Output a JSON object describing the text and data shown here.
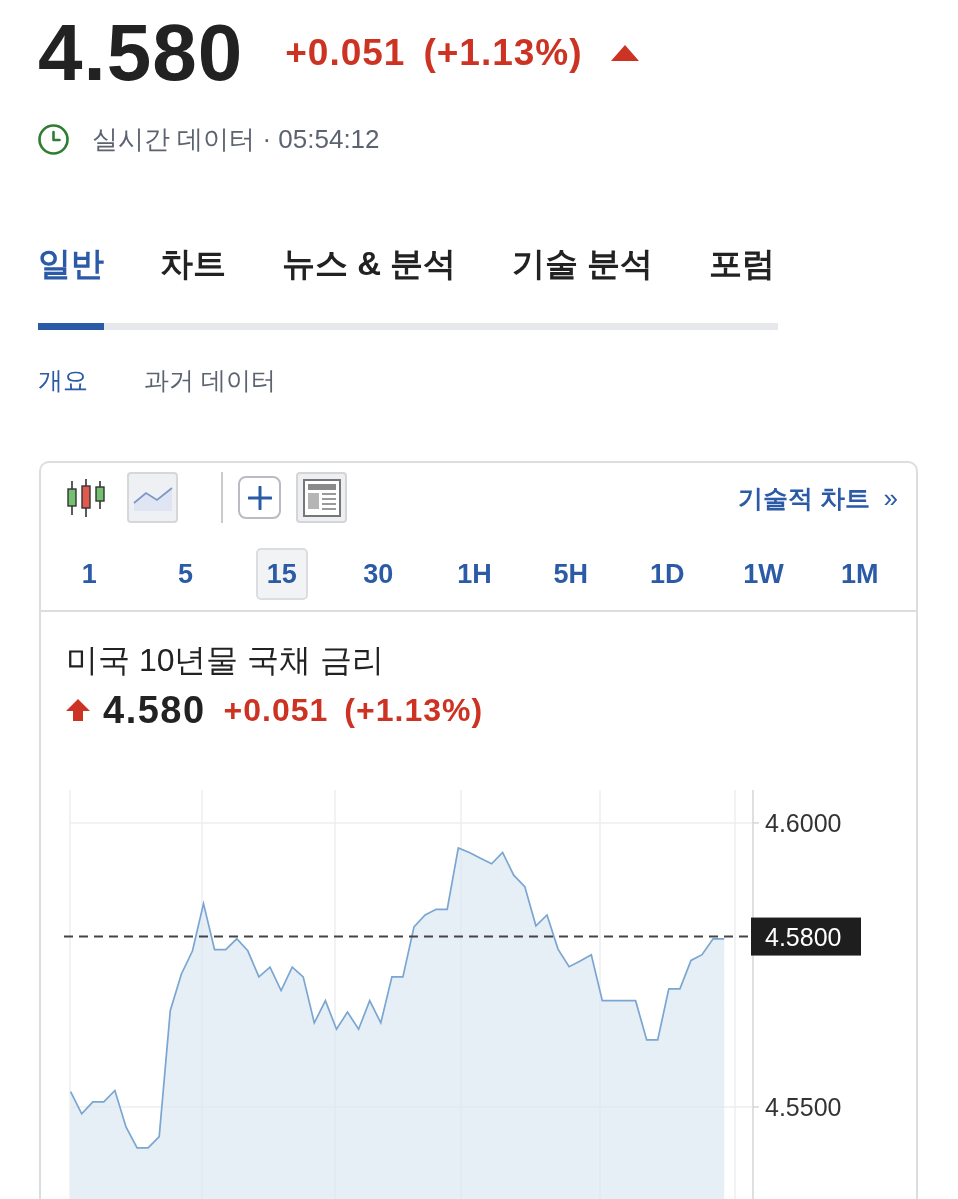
{
  "quote": {
    "price": "4.580",
    "change": "+0.051",
    "change_percent": "(+1.13%)",
    "rising": true
  },
  "status": {
    "text": "실시간 데이터 · 05:54:12"
  },
  "tabs": [
    {
      "label": "일반",
      "selected": true
    },
    {
      "label": "차트",
      "selected": false
    },
    {
      "label": "뉴스 & 분석",
      "selected": false
    },
    {
      "label": "기술 분석",
      "selected": false
    },
    {
      "label": "포럼",
      "selected": false
    }
  ],
  "subtabs": [
    {
      "label": "개요",
      "selected": true
    },
    {
      "label": "과거 데이터",
      "selected": false
    }
  ],
  "chart_widget": {
    "chart_types": [
      {
        "kind": "candlestick",
        "selected": false
      },
      {
        "kind": "line",
        "selected": true
      }
    ],
    "tools": [
      {
        "kind": "add"
      },
      {
        "kind": "layout"
      }
    ],
    "link": {
      "label": "기술적 차트",
      "chevron": "»"
    },
    "intervals": [
      {
        "label": "1",
        "selected": false
      },
      {
        "label": "5",
        "selected": false
      },
      {
        "label": "15",
        "selected": true
      },
      {
        "label": "30",
        "selected": false
      },
      {
        "label": "1H",
        "selected": false
      },
      {
        "label": "5H",
        "selected": false
      },
      {
        "label": "1D",
        "selected": false
      },
      {
        "label": "1W",
        "selected": false
      },
      {
        "label": "1M",
        "selected": false
      }
    ],
    "instrument": {
      "name": "미국 10년물 국채 금리",
      "rising": true,
      "price": "4.580",
      "change": "+0.051",
      "change_percent": "(+1.13%)"
    },
    "chart_data": {
      "type": "area",
      "values": [
        4.5527,
        4.5488,
        4.5509,
        4.5509,
        4.5529,
        4.5465,
        4.5428,
        4.5428,
        4.5448,
        4.567,
        4.5734,
        4.5775,
        4.5858,
        4.5777,
        4.5777,
        4.5796,
        4.5775,
        4.5729,
        4.5746,
        4.5705,
        4.5746,
        4.5729,
        4.5648,
        4.5687,
        4.5637,
        4.5667,
        4.5637,
        4.5687,
        4.5648,
        4.5729,
        4.5729,
        4.5817,
        4.5838,
        4.5848,
        4.5848,
        4.5956,
        4.5948,
        4.5938,
        4.5928,
        4.5948,
        4.5908,
        4.5888,
        4.5819,
        4.5838,
        4.5778,
        4.5747,
        4.5757,
        4.5768,
        4.5687,
        4.5687,
        4.5687,
        4.5687,
        4.5618,
        4.5618,
        4.5708,
        4.5708,
        4.5758,
        4.5768,
        4.5796,
        4.5796
      ],
      "ylim": [
        4.5338,
        4.6058
      ],
      "yticks": [
        {
          "value": 4.6,
          "label": "4.6000"
        },
        {
          "value": 4.55,
          "label": "4.5500"
        }
      ],
      "grid": true,
      "ref_lines": [
        {
          "axis": "y",
          "value": 4.58,
          "label": "4.5800"
        }
      ]
    }
  }
}
